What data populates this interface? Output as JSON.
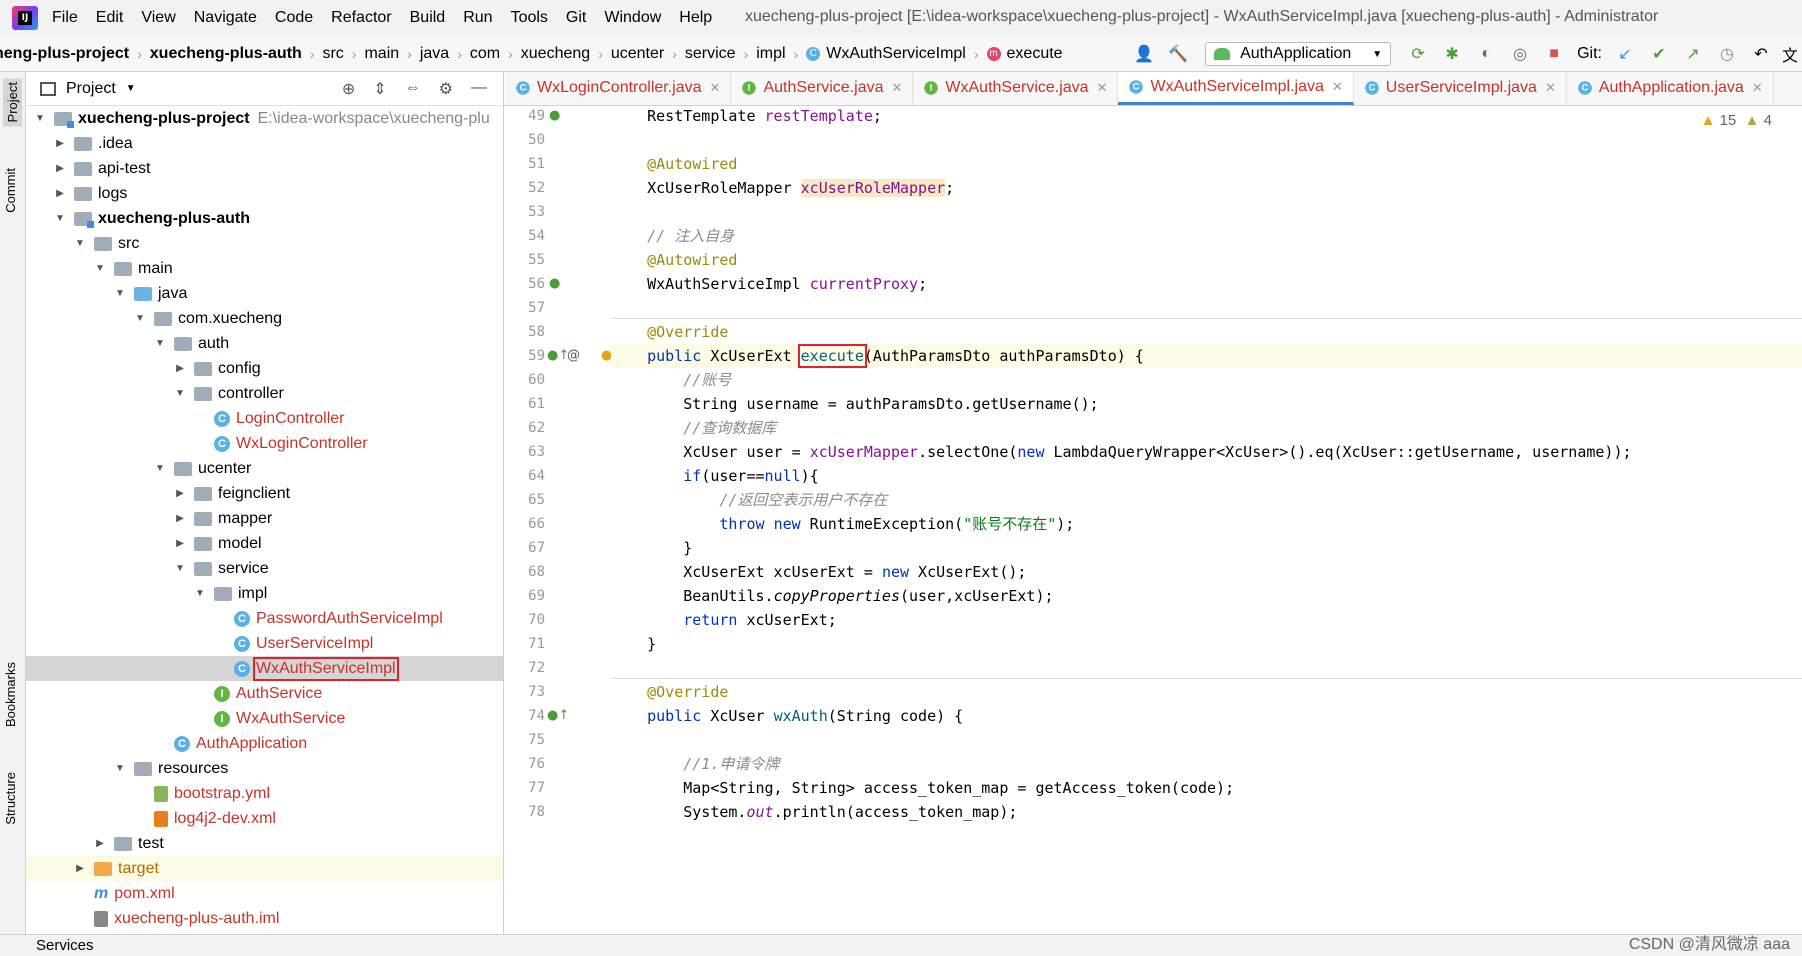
{
  "menubar": {
    "items": [
      "File",
      "Edit",
      "View",
      "Navigate",
      "Code",
      "Refactor",
      "Build",
      "Run",
      "Tools",
      "Git",
      "Window",
      "Help"
    ],
    "title": "xuecheng-plus-project [E:\\idea-workspace\\xuecheng-plus-project] - WxAuthServiceImpl.java [xuecheng-plus-auth] - Administrator"
  },
  "breadcrumbs": [
    "heng-plus-project",
    "xuecheng-plus-auth",
    "src",
    "main",
    "java",
    "com",
    "xuecheng",
    "ucenter",
    "service",
    "impl",
    "WxAuthServiceImpl",
    "execute"
  ],
  "run_config": "AuthApplication",
  "git_label": "Git:",
  "side_tabs": {
    "project": "Project",
    "commit": "Commit",
    "bookmarks": "Bookmarks",
    "structure": "Structure"
  },
  "project_panel": {
    "title": "Project",
    "tree": [
      {
        "label": "xuecheng-plus-project",
        "suffix": "E:\\idea-workspace\\xuecheng-plu",
        "depth": 0,
        "open": true,
        "bold": true,
        "icon": "module-folder"
      },
      {
        "label": ".idea",
        "depth": 1,
        "open": false,
        "icon": "folder"
      },
      {
        "label": "api-test",
        "depth": 1,
        "open": false,
        "icon": "folder"
      },
      {
        "label": "logs",
        "depth": 1,
        "open": false,
        "icon": "folder"
      },
      {
        "label": "xuecheng-plus-auth",
        "depth": 1,
        "open": true,
        "bold": true,
        "icon": "module-folder"
      },
      {
        "label": "src",
        "depth": 2,
        "open": true,
        "icon": "folder"
      },
      {
        "label": "main",
        "depth": 3,
        "open": true,
        "icon": "folder"
      },
      {
        "label": "java",
        "depth": 4,
        "open": true,
        "icon": "folder-blue"
      },
      {
        "label": "com.xuecheng",
        "depth": 5,
        "open": true,
        "icon": "folder"
      },
      {
        "label": "auth",
        "depth": 6,
        "open": true,
        "icon": "folder"
      },
      {
        "label": "config",
        "depth": 7,
        "open": false,
        "icon": "folder"
      },
      {
        "label": "controller",
        "depth": 7,
        "open": true,
        "icon": "folder"
      },
      {
        "label": "LoginController",
        "depth": 8,
        "icon": "class",
        "color": "red"
      },
      {
        "label": "WxLoginController",
        "depth": 8,
        "icon": "class",
        "color": "red"
      },
      {
        "label": "ucenter",
        "depth": 6,
        "open": true,
        "icon": "folder"
      },
      {
        "label": "feignclient",
        "depth": 7,
        "open": false,
        "icon": "folder"
      },
      {
        "label": "mapper",
        "depth": 7,
        "open": false,
        "icon": "folder"
      },
      {
        "label": "model",
        "depth": 7,
        "open": false,
        "icon": "folder"
      },
      {
        "label": "service",
        "depth": 7,
        "open": true,
        "icon": "folder"
      },
      {
        "label": "impl",
        "depth": 8,
        "open": true,
        "icon": "folder"
      },
      {
        "label": "PasswordAuthServiceImpl",
        "depth": 9,
        "icon": "class",
        "color": "red"
      },
      {
        "label": "UserServiceImpl",
        "depth": 9,
        "icon": "class",
        "color": "red"
      },
      {
        "label": "WxAuthServiceImpl",
        "depth": 9,
        "icon": "class",
        "color": "red",
        "selected": true,
        "boxed": true
      },
      {
        "label": "AuthService",
        "depth": 8,
        "icon": "interface",
        "color": "red"
      },
      {
        "label": "WxAuthService",
        "depth": 8,
        "icon": "interface",
        "color": "red"
      },
      {
        "label": "AuthApplication",
        "depth": 6,
        "icon": "class",
        "color": "red"
      },
      {
        "label": "resources",
        "depth": 4,
        "open": true,
        "icon": "folder"
      },
      {
        "label": "bootstrap.yml",
        "depth": 5,
        "icon": "yml",
        "color": "red"
      },
      {
        "label": "log4j2-dev.xml",
        "depth": 5,
        "icon": "xml",
        "color": "red"
      },
      {
        "label": "test",
        "depth": 3,
        "open": false,
        "icon": "folder"
      },
      {
        "label": "target",
        "depth": 2,
        "open": false,
        "icon": "folder-orange",
        "color": "orange",
        "highlight": true
      },
      {
        "label": "pom.xml",
        "depth": 2,
        "icon": "maven",
        "color": "red"
      },
      {
        "label": "xuecheng-plus-auth.iml",
        "depth": 2,
        "icon": "iml",
        "color": "red"
      }
    ]
  },
  "editor": {
    "tabs": [
      {
        "label": "WxLoginController.java",
        "icon": "class"
      },
      {
        "label": "AuthService.java",
        "icon": "interface"
      },
      {
        "label": "WxAuthService.java",
        "icon": "interface"
      },
      {
        "label": "WxAuthServiceImpl.java",
        "icon": "class",
        "active": true
      },
      {
        "label": "UserServiceImpl.java",
        "icon": "class"
      },
      {
        "label": "AuthApplication.java",
        "icon": "class"
      }
    ],
    "warnings": "15",
    "weak_warnings": "4",
    "lines": [
      {
        "n": "49",
        "code": [
          [
            "    RestTemplate ",
            ""
          ],
          [
            "restTemplate",
            "fld"
          ],
          [
            ";",
            ""
          ]
        ]
      },
      {
        "n": "50",
        "code": []
      },
      {
        "n": "51",
        "code": [
          [
            "    @Autowired",
            "ann"
          ]
        ]
      },
      {
        "n": "52",
        "code": [
          [
            "    XcUserRoleMapper ",
            ""
          ],
          [
            "xcUserRoleMapper",
            "fld pad"
          ],
          [
            ";",
            ""
          ]
        ]
      },
      {
        "n": "53",
        "code": []
      },
      {
        "n": "54",
        "code": [
          [
            "    // 注入自身",
            "cmt"
          ]
        ]
      },
      {
        "n": "55",
        "code": [
          [
            "    @Autowired",
            "ann"
          ]
        ]
      },
      {
        "n": "56",
        "code": [
          [
            "    WxAuthServiceImpl ",
            ""
          ],
          [
            "currentProxy",
            "fld"
          ],
          [
            ";",
            ""
          ]
        ]
      },
      {
        "n": "57",
        "code": []
      },
      {
        "n": "58",
        "code": [
          [
            "    @Override",
            "ann"
          ]
        ]
      },
      {
        "n": "59",
        "code": [
          [
            "    ",
            ""
          ],
          [
            "public",
            "kw"
          ],
          [
            " XcUserExt ",
            ""
          ],
          [
            "execute",
            "mth box"
          ],
          [
            "(AuthParamsDto authParamsDto) {",
            ""
          ]
        ]
      },
      {
        "n": "60",
        "code": [
          [
            "        //账号",
            "cmt"
          ]
        ]
      },
      {
        "n": "61",
        "code": [
          [
            "        String username = authParamsDto.getUsername();",
            ""
          ]
        ]
      },
      {
        "n": "62",
        "code": [
          [
            "        //查询数据库",
            "cmt"
          ]
        ]
      },
      {
        "n": "63",
        "code": [
          [
            "        XcUser user = ",
            ""
          ],
          [
            "xcUserMapper",
            "fld"
          ],
          [
            ".selectOne(",
            ""
          ],
          [
            "new",
            "kw"
          ],
          [
            " LambdaQueryWrapper<XcUser>().eq(XcUser::getUsername, username));",
            ""
          ]
        ]
      },
      {
        "n": "64",
        "code": [
          [
            "        ",
            ""
          ],
          [
            "if",
            "kw"
          ],
          [
            "(user==",
            ""
          ],
          [
            "null",
            "kw"
          ],
          [
            "){",
            ""
          ]
        ]
      },
      {
        "n": "65",
        "code": [
          [
            "            //返回空表示用户不存在",
            "cmt"
          ]
        ]
      },
      {
        "n": "66",
        "code": [
          [
            "            ",
            ""
          ],
          [
            "throw",
            "kw"
          ],
          [
            " ",
            ""
          ],
          [
            "new",
            "kw"
          ],
          [
            " RuntimeException(",
            ""
          ],
          [
            "\"账号不存在\"",
            "str"
          ],
          [
            ");",
            ""
          ]
        ]
      },
      {
        "n": "67",
        "code": [
          [
            "        }",
            ""
          ]
        ]
      },
      {
        "n": "68",
        "code": [
          [
            "        XcUserExt xcUserExt = ",
            ""
          ],
          [
            "new",
            "kw"
          ],
          [
            " XcUserExt();",
            ""
          ]
        ]
      },
      {
        "n": "69",
        "code": [
          [
            "        BeanUtils.",
            ""
          ],
          [
            "copyProperties",
            "stat"
          ],
          [
            "(user,xcUserExt);",
            ""
          ]
        ]
      },
      {
        "n": "70",
        "code": [
          [
            "        ",
            ""
          ],
          [
            "return",
            "kw"
          ],
          [
            " xcUserExt;",
            ""
          ]
        ]
      },
      {
        "n": "71",
        "code": [
          [
            "    }",
            ""
          ]
        ]
      },
      {
        "n": "72",
        "code": []
      },
      {
        "n": "73",
        "code": [
          [
            "    @Override",
            "ann"
          ]
        ]
      },
      {
        "n": "74",
        "code": [
          [
            "    ",
            ""
          ],
          [
            "public",
            "kw"
          ],
          [
            " XcUser ",
            ""
          ],
          [
            "wxAuth",
            "mth"
          ],
          [
            "(String code) {",
            ""
          ]
        ]
      },
      {
        "n": "75",
        "code": []
      },
      {
        "n": "76",
        "code": [
          [
            "        //1.申请令牌",
            "cmt"
          ]
        ]
      },
      {
        "n": "77",
        "code": [
          [
            "        Map<String, String> access_token_map = getAccess_token(code);",
            ""
          ]
        ]
      },
      {
        "n": "78",
        "code": [
          [
            "        System.",
            ""
          ],
          [
            "out",
            "fld stat"
          ],
          [
            ".println(access_token_map);",
            ""
          ]
        ]
      }
    ]
  },
  "status_bar": {
    "services": "Services",
    "watermark": "CSDN @清风微凉 aaa"
  }
}
